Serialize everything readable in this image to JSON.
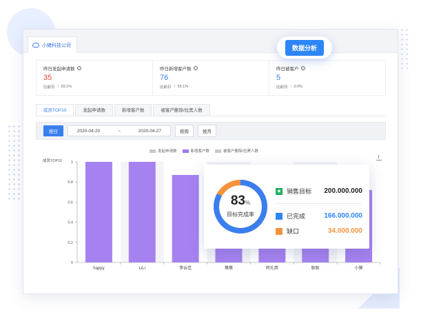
{
  "company_tab": "小猪科技公司",
  "float_button": "数据分析",
  "stats": [
    {
      "title": "昨日发起申请数",
      "value": "35",
      "value_color": "#e2443b",
      "compare_label": "比前日",
      "change": "59.1%"
    },
    {
      "title": "昨日新增客户数",
      "value": "76",
      "value_color": "#3a7ff0",
      "compare_label": "比前日",
      "change": "55.1%"
    },
    {
      "title": "昨日被客户",
      "value": "5",
      "value_color": "#3a7ff0",
      "compare_label": "比前日",
      "change": "0.0%"
    }
  ],
  "tabs": [
    "成员TOP10",
    "发起申请数",
    "新增客户数",
    "被客户删除/拉黑人数"
  ],
  "filter": {
    "by_day": "按日",
    "date_start": "2020-04-20",
    "date_sep": "~",
    "date_end": "2020-04-27",
    "by_week": "按周",
    "by_month": "按月"
  },
  "chart_data": {
    "type": "bar",
    "title": "成员TOP10",
    "legend": [
      {
        "name": "发起申请数",
        "color": "#c8c8c8"
      },
      {
        "name": "新增客户数",
        "color": "#9e78ef"
      },
      {
        "name": "被客户删除/拉黑人数",
        "color": "#c8c8c8"
      }
    ],
    "categories": [
      "happy",
      "LiLi",
      "李云佳",
      "蔡蔡",
      "阿扎西",
      "耿耿",
      "小葵"
    ],
    "series": [
      {
        "name": "新增客户数",
        "values": [
          1,
          1,
          0.87,
          0.78,
          0.72,
          0.72,
          0.72
        ]
      }
    ],
    "yticks": [
      "0",
      "0.2",
      "0.4",
      "0.6",
      "0.8",
      "1"
    ],
    "ylim": [
      0,
      1
    ],
    "bar_color": "#a682f0",
    "alt_band_color": "#f4f4f8"
  },
  "kpi": {
    "percent": "83",
    "percent_sign": "%",
    "percent_value": 0.83,
    "label": "目标完成率",
    "ring_color": "#3a7ff0",
    "ring_rest_color": "#f5923e",
    "rows": [
      {
        "name": "销售目标",
        "value": "200.000.000",
        "color": "#1cb05a",
        "value_color": "#222",
        "icon": "star-icon"
      },
      {
        "name": "已完成",
        "value": "166.000.000",
        "color": "#2d86f5",
        "value_color": "#2d86f5",
        "icon": "square-icon"
      },
      {
        "name": "缺口",
        "value": "34.000.000",
        "color": "#f5923e",
        "value_color": "#f5923e",
        "icon": "square-icon"
      }
    ]
  }
}
